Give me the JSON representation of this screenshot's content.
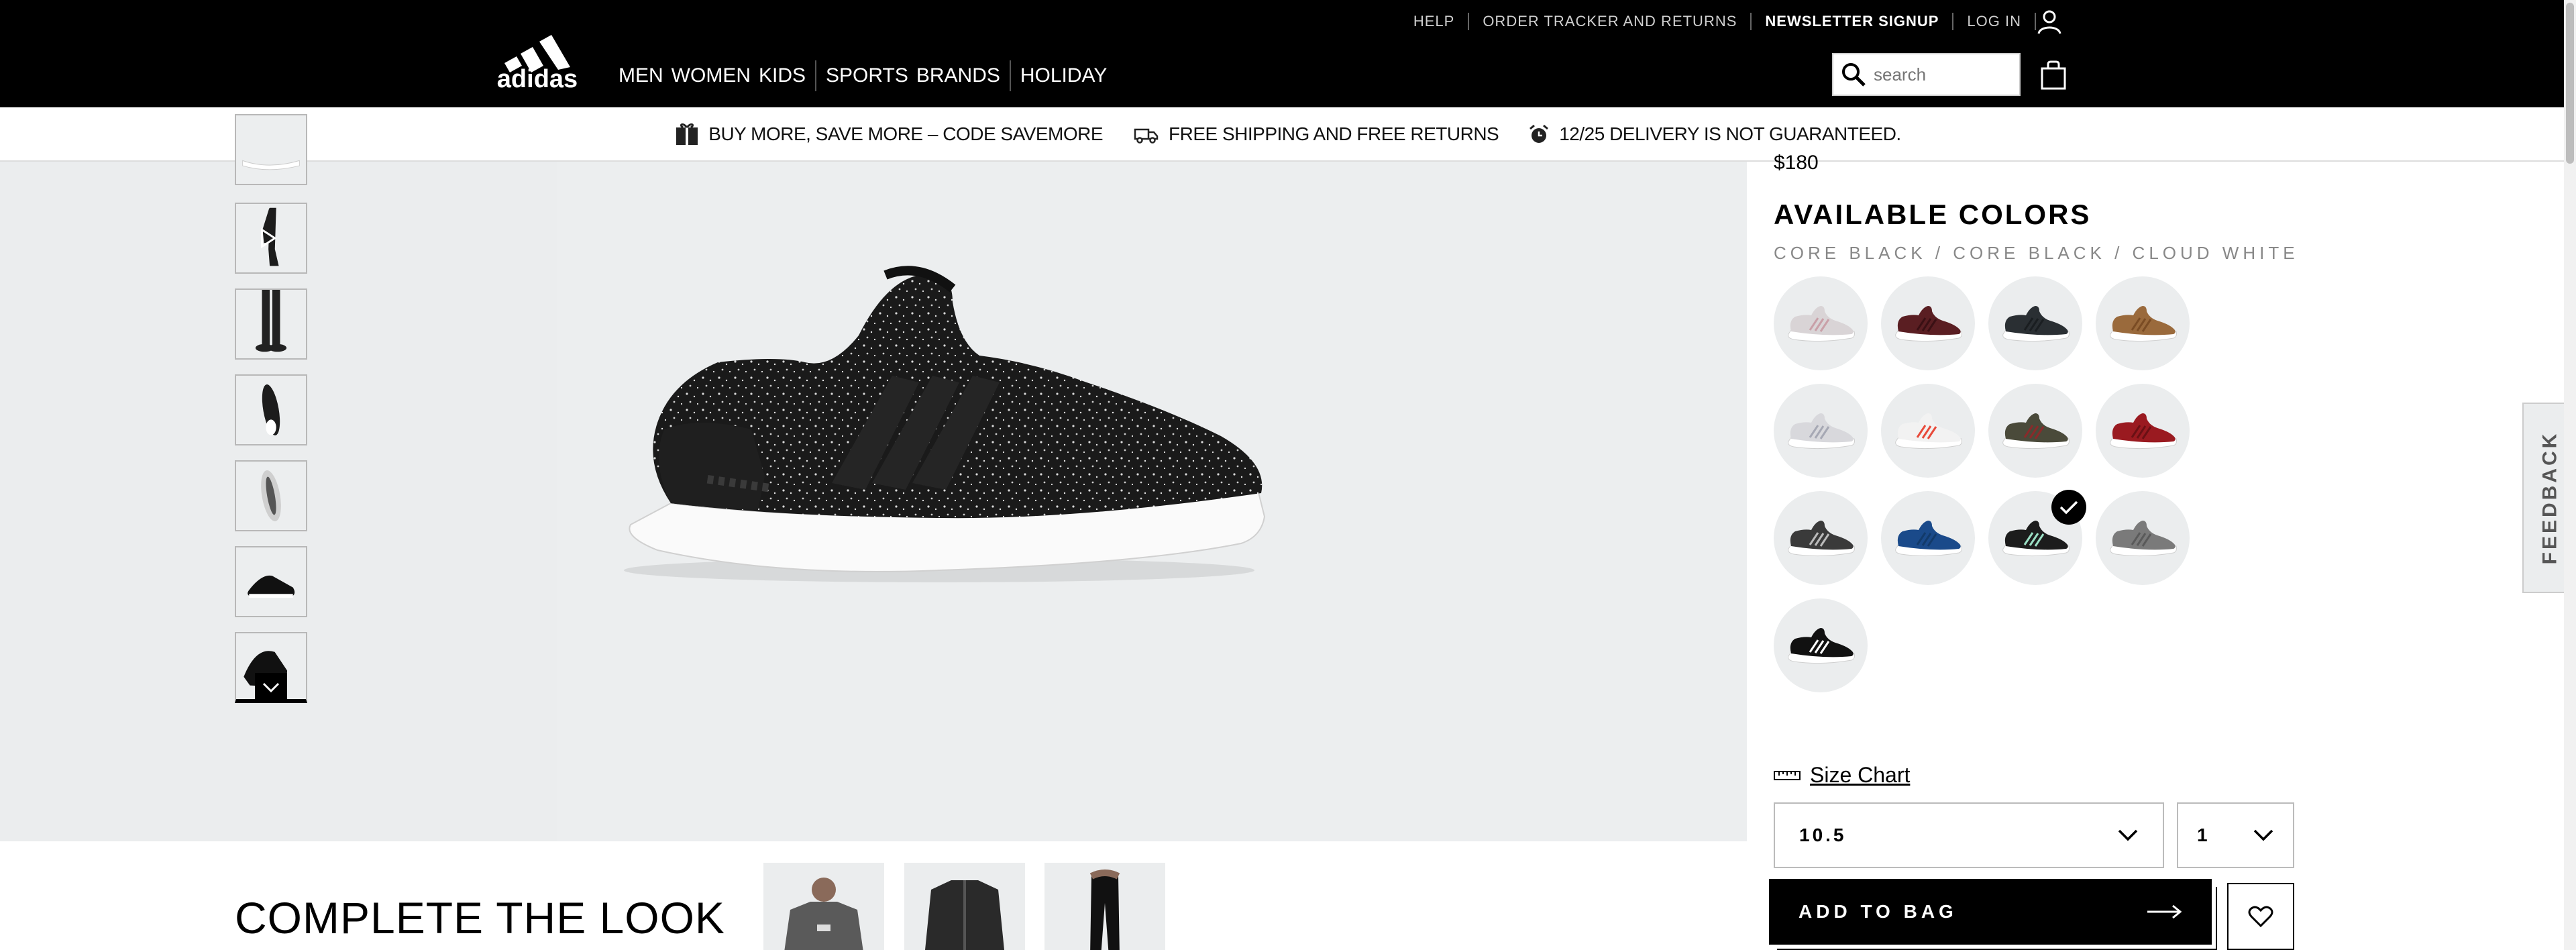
{
  "utility_nav": {
    "help": "HELP",
    "order_tracker": "ORDER TRACKER AND RETURNS",
    "newsletter": "NEWSLETTER SIGNUP",
    "login": "LOG IN"
  },
  "brand": {
    "logo_text": "adidas"
  },
  "main_nav": [
    "MEN",
    "WOMEN",
    "KIDS",
    "SPORTS",
    "BRANDS",
    "HOLIDAY"
  ],
  "search": {
    "placeholder": "search"
  },
  "promo": {
    "item1": "BUY MORE, SAVE MORE – CODE SAVEMORE",
    "item2": "FREE SHIPPING AND FREE RETURNS",
    "item3": "12/25 DELIVERY IS NOT GUARANTEED."
  },
  "product": {
    "price": "$180",
    "available_colors_title": "AVAILABLE COLORS",
    "color_name": "CORE BLACK / CORE BLACK / CLOUD WHITE",
    "size_chart": "Size Chart",
    "size_value": "10.5",
    "qty_value": "1",
    "add_to_bag": "ADD TO BAG"
  },
  "swatches": [
    {
      "upper": "#d9d4d6",
      "accent": "#c9a0a8",
      "sole": "#ffffff"
    },
    {
      "upper": "#5a1e22",
      "accent": "#3a1014",
      "sole": "#ffffff"
    },
    {
      "upper": "#2a2f33",
      "accent": "#1a1e21",
      "sole": "#ffffff"
    },
    {
      "upper": "#9a6a3c",
      "accent": "#7a4c24",
      "sole": "#ffffff"
    },
    {
      "upper": "#d8d8dc",
      "accent": "#a6a8b4",
      "sole": "#ffffff"
    },
    {
      "upper": "#f2f2f2",
      "accent": "#e84a3a",
      "sole": "#ffffff"
    },
    {
      "upper": "#4a4a3a",
      "accent": "#8a2a2a",
      "sole": "#ffffff"
    },
    {
      "upper": "#9a1a20",
      "accent": "#6a1014",
      "sole": "#ffffff"
    },
    {
      "upper": "#3a3a3a",
      "accent": "#bbbbbb",
      "sole": "#ffffff"
    },
    {
      "upper": "#1a4a8a",
      "accent": "#123a6a",
      "sole": "#ffffff"
    },
    {
      "upper": "#1c1c1c",
      "accent": "#9adfc4",
      "sole": "#ffffff"
    },
    {
      "upper": "#7a7a7a",
      "accent": "#5a5a5a",
      "sole": "#ffffff"
    },
    {
      "upper": "#111111",
      "accent": "#ffffff",
      "sole": "#ffffff"
    }
  ],
  "selected_swatch": 10,
  "complete_the_look": {
    "title": "COMPLETE THE LOOK"
  },
  "feedback": "FEEDBACK"
}
